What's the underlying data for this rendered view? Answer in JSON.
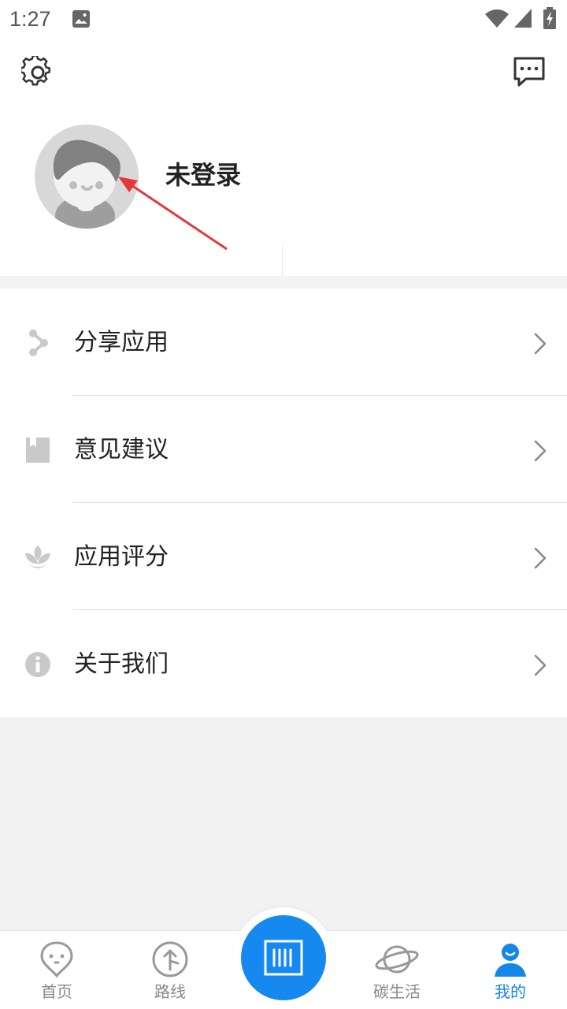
{
  "status_bar": {
    "time": "1:27",
    "icons": [
      "image-notification-icon",
      "wifi-icon",
      "cellular-signal-icon",
      "battery-charging-icon"
    ]
  },
  "header": {
    "settings_icon": "gear-icon",
    "messages_icon": "message-dots-icon"
  },
  "profile": {
    "login_status": "未登录",
    "avatar_icon": "default-user-avatar"
  },
  "menu": {
    "items": [
      {
        "label": "分享应用",
        "icon": "share-icon"
      },
      {
        "label": "意见建议",
        "icon": "feedback-bookmark-icon"
      },
      {
        "label": "应用评分",
        "icon": "leaf-rating-icon"
      },
      {
        "label": "关于我们",
        "icon": "info-icon"
      }
    ]
  },
  "bottom_nav": {
    "tabs": [
      {
        "label": "首页",
        "icon": "map-pin-home-icon",
        "active": false
      },
      {
        "label": "路线",
        "icon": "route-arrow-icon",
        "active": false
      },
      {
        "label": "碳生活",
        "icon": "planet-icon",
        "active": false
      },
      {
        "label": "我的",
        "icon": "person-icon",
        "active": true
      }
    ],
    "center_action_icon": "barcode-scan-icon"
  },
  "colors": {
    "accent": "#1689F0",
    "annotation": "#E23A3A",
    "background": "#F2F2F2",
    "surface": "#FFFFFF",
    "muted_icon": "#C9C9C9"
  }
}
